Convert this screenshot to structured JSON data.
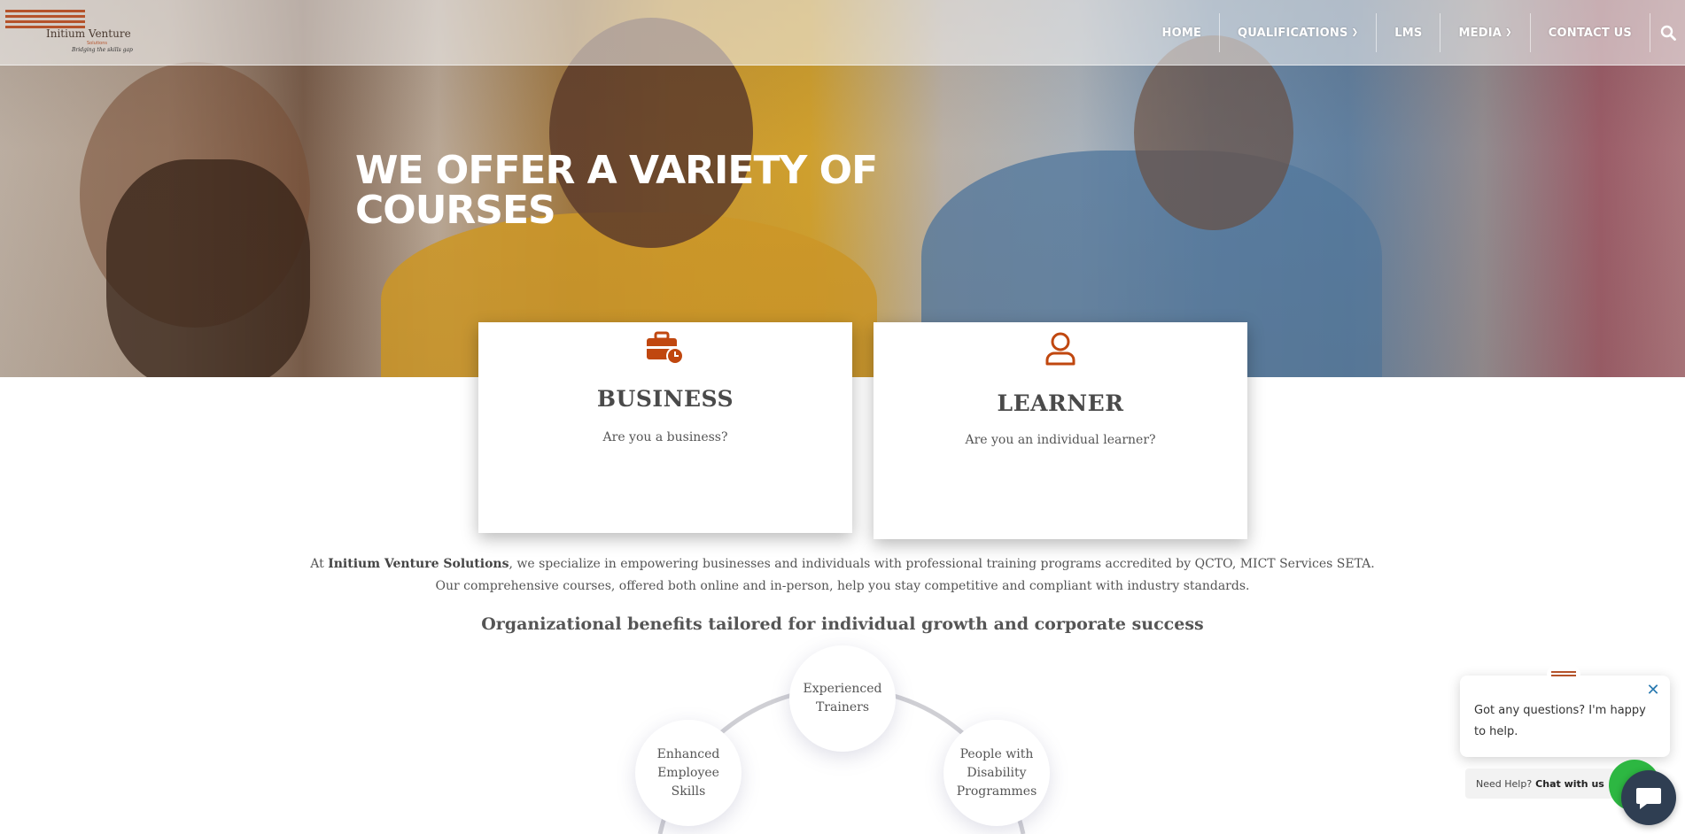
{
  "header": {
    "logo": {
      "name": "Initium Venture",
      "sub": "Solutions",
      "tagline": "Bridging the skills gap"
    },
    "nav": [
      {
        "label": "HOME",
        "has_dropdown": false
      },
      {
        "label": "QUALIFICATIONS",
        "has_dropdown": true
      },
      {
        "label": "LMS",
        "has_dropdown": false
      },
      {
        "label": "MEDIA",
        "has_dropdown": true
      },
      {
        "label": "CONTACT US",
        "has_dropdown": false
      }
    ],
    "search_icon": "search-icon"
  },
  "hero": {
    "title": "WE OFFER A VARIETY OF COURSES"
  },
  "cards": {
    "business": {
      "icon": "briefcase-clock-icon",
      "title": "BUSINESS",
      "text": "Are you a business?"
    },
    "learner": {
      "icon": "user-icon",
      "title": "LEARNER",
      "text": "Are you an individual learner?"
    }
  },
  "intro": {
    "prefix": "At ",
    "company": "Initium Venture Solutions",
    "line1_rest": ", we specialize in empowering businesses and individuals with professional training programs accredited by QCTO, MICT Services SETA.",
    "line2": "Our comprehensive courses, offered both online and in-person, help you stay competitive and compliant with industry standards."
  },
  "benefits": {
    "title": "Organizational benefits tailored for individual growth and corporate success",
    "items": [
      "Enhanced Employee Skills",
      "Experienced Trainers",
      "People with Disability Programmes"
    ]
  },
  "chat": {
    "message": "Got any questions? I'm happy to help.",
    "cta_prefix": "Need Help?",
    "cta_strong": "Chat with us"
  },
  "colors": {
    "accent": "#c0470f",
    "text": "#555555",
    "whatsapp": "#2db742",
    "chat_button": "#2f3e52"
  }
}
